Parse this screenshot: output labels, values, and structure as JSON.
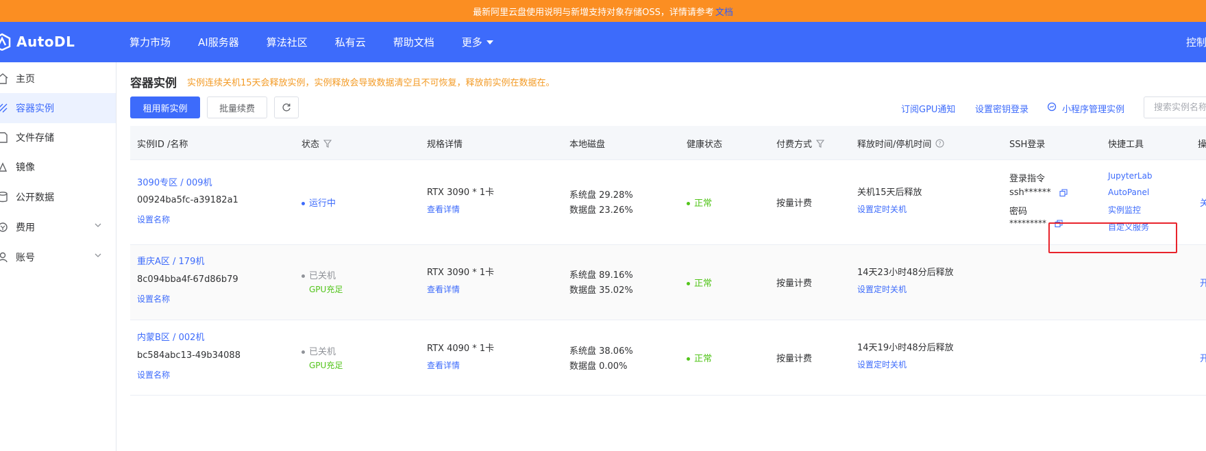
{
  "announcement": {
    "text": "最新阿里云盘使用说明与新增支持对象存储OSS，详情请参考",
    "link_text": "文档"
  },
  "brand": {
    "name": "AutoDL"
  },
  "nav": {
    "items": [
      "算力市场",
      "AI服务器",
      "算法社区",
      "私有云",
      "帮助文档",
      "更多"
    ],
    "console": "控制台"
  },
  "sidebar": {
    "items": [
      {
        "label": "主页",
        "icon": "home-icon"
      },
      {
        "label": "容器实例",
        "icon": "container-icon",
        "active": true
      },
      {
        "label": "文件存储",
        "icon": "file-icon"
      },
      {
        "label": "镜像",
        "icon": "image-icon"
      },
      {
        "label": "公开数据",
        "icon": "database-icon"
      },
      {
        "label": "费用",
        "icon": "cost-icon",
        "expandable": true
      },
      {
        "label": "账号",
        "icon": "user-icon",
        "expandable": true
      }
    ]
  },
  "page": {
    "title": "容器实例",
    "notice": "实例连续关机15天会释放实例，实例释放会导致数据清空且不可恢复，释放前实例在数据在。"
  },
  "toolbar": {
    "rent_button": "租用新实例",
    "renew_button": "批量续费",
    "subscribe_link": "订阅GPU通知",
    "key_link": "设置密钥登录",
    "miniapp_link": "小程序管理实例",
    "search_placeholder": "搜索实例名称"
  },
  "table": {
    "columns": [
      "实例ID /名称",
      "状态",
      "规格详情",
      "本地磁盘",
      "健康状态",
      "付费方式",
      "释放时间/停机时间",
      "SSH登录",
      "快捷工具",
      "操作"
    ],
    "rows": [
      {
        "name": "3090专区 / 009机",
        "id": "00924ba5fc-a39182a1",
        "set_name": "设置名称",
        "status": "运行中",
        "status_sub": "",
        "spec": "RTX 3090 * 1卡",
        "spec_detail": "查看详情",
        "sys_disk": "系统盘 29.28%",
        "data_disk": "数据盘 23.26%",
        "health": "正常",
        "billing": "按量计费",
        "release": "关机15天后释放",
        "timer": "设置定时关机",
        "ssh_label": "登录指令",
        "ssh_cmd": "ssh******",
        "pwd_label": "密码",
        "pwd": "*********",
        "tools": [
          "JupyterLab",
          "AutoPanel",
          "实例监控",
          "自定义服务"
        ],
        "action": "关机"
      },
      {
        "name": "重庆A区 / 179机",
        "id": "8c094bba4f-67d86b79",
        "set_name": "设置名称",
        "status": "已关机",
        "status_sub": "GPU充足",
        "spec": "RTX 3090 * 1卡",
        "spec_detail": "查看详情",
        "sys_disk": "系统盘 89.16%",
        "data_disk": "数据盘 35.02%",
        "health": "正常",
        "billing": "按量计费",
        "release": "14天23小时48分后释放",
        "timer": "设置定时关机",
        "action": "开机"
      },
      {
        "name": "内蒙B区 / 002机",
        "id": "bc584abc13-49b34088",
        "set_name": "设置名称",
        "status": "已关机",
        "status_sub": "GPU充足",
        "spec": "RTX 4090 * 1卡",
        "spec_detail": "查看详情",
        "sys_disk": "系统盘 38.06%",
        "data_disk": "数据盘 0.00%",
        "health": "正常",
        "billing": "按量计费",
        "release": "14天19小时48分后释放",
        "timer": "设置定时关机",
        "action": "开机"
      }
    ]
  },
  "colors": {
    "announcement_bg": "#fb8e22",
    "primary": "#3d6bfb",
    "notice": "#f39b26",
    "healthy": "#52c41a",
    "highlight": "#e8232b"
  }
}
